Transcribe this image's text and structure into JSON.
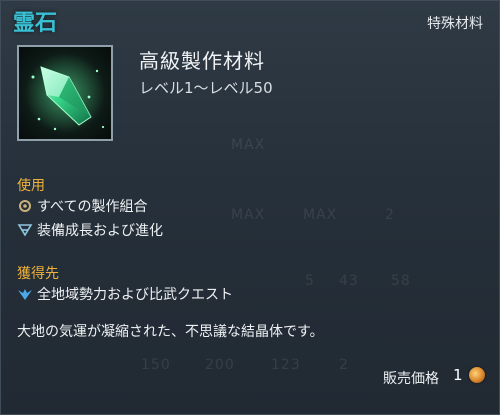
{
  "item": {
    "title": "霊石",
    "category": "特殊材料",
    "name": "高級製作材料",
    "level_range": "レベル1～レベル50"
  },
  "usage": {
    "heading": "使用",
    "lines": [
      "すべての製作組合",
      "装備成長および進化"
    ]
  },
  "acquire": {
    "heading": "獲得先",
    "lines": [
      "全地域勢力および比武クエスト"
    ]
  },
  "description": "大地の気運が凝縮された、不思議な結晶体です。",
  "price": {
    "label": "販売価格",
    "value": "1"
  },
  "background_text": [
    "MAX",
    "MAX",
    "MAX",
    "2",
    "5",
    "43",
    "58",
    "150",
    "200",
    "123",
    "2"
  ],
  "colors": {
    "title": "#38c0d4",
    "section_heading": "#f0b23a",
    "coin": "#d9862a"
  },
  "icons": [
    "green-crystal-icon",
    "crafting-tools-icon",
    "equipment-growth-icon",
    "quest-wing-icon",
    "coin-icon"
  ]
}
